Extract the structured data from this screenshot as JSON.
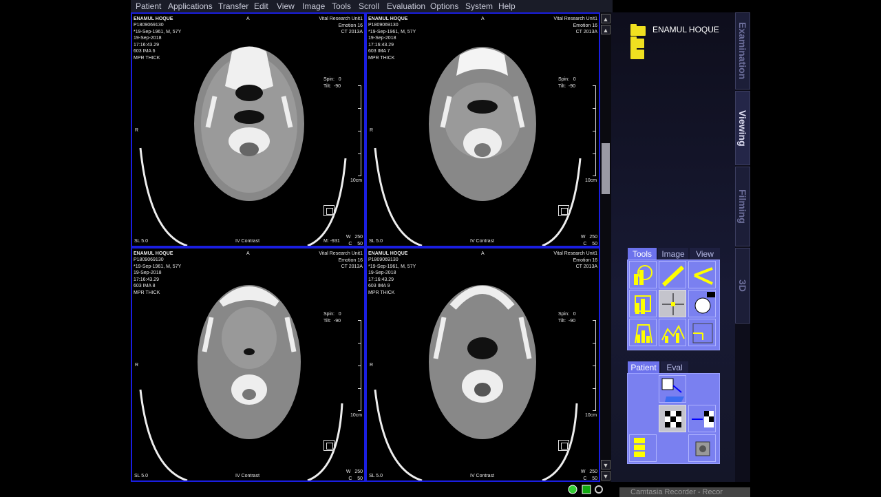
{
  "menu": [
    "Patient",
    "Applications",
    "Transfer",
    "Edit",
    "View",
    "Image",
    "Tools",
    "Scroll",
    "Evaluation",
    "Options",
    "System",
    "Help"
  ],
  "segments": [
    {
      "name": "ENAMUL HOQUE",
      "info": "P1809069130\n*19-Sep-1961, M, 57Y\n19-Sep-2018\n17:16:43.29\n603 IMA 6\nMPR THICK",
      "orient_top": "A",
      "orient_left": "R",
      "inst": "Vital Research Unit1\nEmotion 16\nCT 2013A",
      "spin": "Spin:   0\nTilt:  -90",
      "scale": "10cm",
      "sl": "SL 5.0",
      "contrast": "IV Contrast",
      "wc": "W   250\nC    50",
      "extra": "M: -931"
    },
    {
      "name": "ENAMUL HOQUE",
      "info": "P1809069130\n*19-Sep-1961, M, 57Y\n19-Sep-2018\n17:16:43.29\n603 IMA 7\nMPR THICK",
      "orient_top": "A",
      "orient_left": "R",
      "inst": "Vital Research Unit1\nEmotion 16\nCT 2013A",
      "spin": "Spin:   0\nTilt:  -90",
      "scale": "10cm",
      "sl": "SL 5.0",
      "contrast": "IV Contrast",
      "wc": "W   250\nC    50",
      "extra": ""
    },
    {
      "name": "ENAMUL HOQUE",
      "info": "P1809069130\n*19-Sep-1961, M, 57Y\n19-Sep-2018\n17:16:43.29\n603 IMA 8\nMPR THICK",
      "orient_top": "A",
      "orient_left": "R",
      "inst": "Vital Research Unit1\nEmotion 16\nCT 2013A",
      "spin": "Spin:   0\nTilt:  -90",
      "scale": "10cm",
      "sl": "SL 5.0",
      "contrast": "IV Contrast",
      "wc": "W   250\nC    50",
      "extra": ""
    },
    {
      "name": "ENAMUL HOQUE",
      "info": "P1809069130\n*19-Sep-1961, M, 57Y\n19-Sep-2018\n17:16:43.29\n603 IMA 9\nMPR THICK",
      "orient_top": "A",
      "orient_left": "R",
      "inst": "Vital Research Unit1\nEmotion 16\nCT 2013A",
      "spin": "Spin:   0\nTilt:  -90",
      "scale": "10cm",
      "sl": "SL 5.0",
      "contrast": "IV Contrast",
      "wc": "W   250\nC    50",
      "extra": ""
    }
  ],
  "side_tabs": [
    "Examination",
    "Viewing",
    "Filming",
    "3D"
  ],
  "patient_folder_label": "ENAMUL HOQUE",
  "tools_tabs": [
    "Tools",
    "Image",
    "View"
  ],
  "patient_tabs": [
    "Patient",
    "Eval"
  ],
  "recorder_text": "Camtasia Recorder - Recor",
  "colors": {
    "accent": "#6c72ec",
    "segment_border": "#1a1ee0",
    "folder": "#f0e020"
  }
}
